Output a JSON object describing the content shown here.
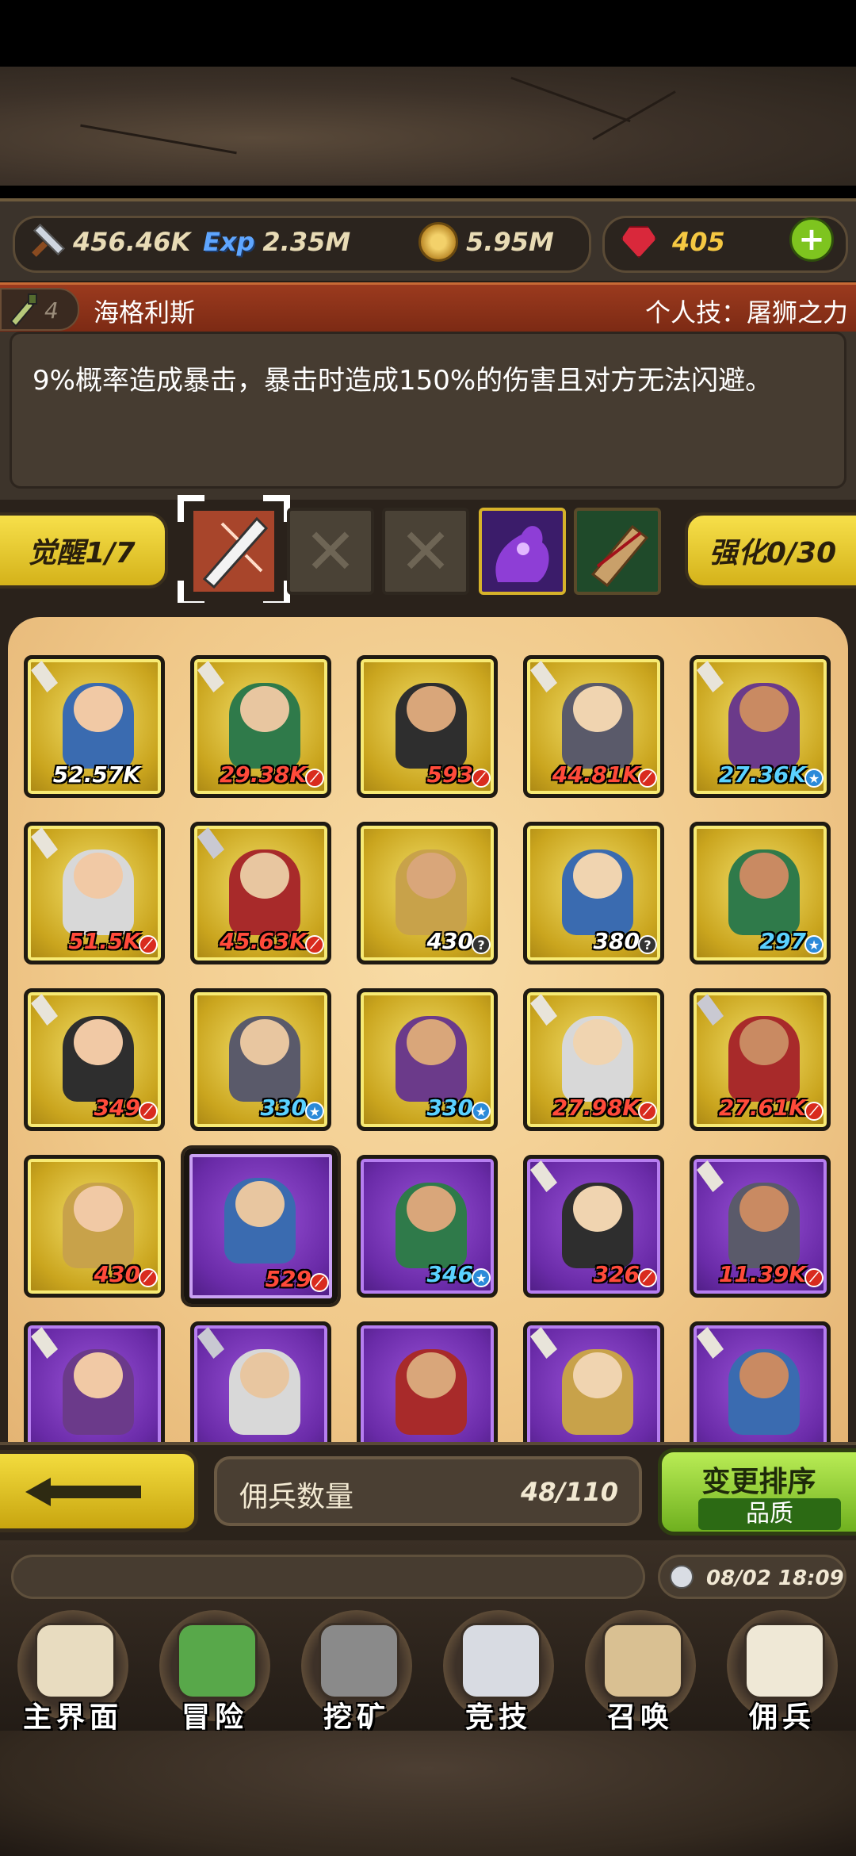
{
  "currency": {
    "attack": "456.46K",
    "exp_label": "Exp",
    "exp": "2.35M",
    "gold": "5.95M",
    "gems": "405",
    "add_label": "+"
  },
  "hero": {
    "level": "4",
    "name": "海格利斯",
    "skill": "个人技：屠狮之力",
    "description": "9%概率造成暴击，暴击时造成150%的伤害且对方无法闪避。"
  },
  "skills": {
    "awaken_label": "觉醒1/7",
    "enhance_label": "强化0/30",
    "empty_mark": "✕"
  },
  "mercenaries": [
    {
      "level": "52.57K",
      "color": "gold",
      "lvcolor": "white",
      "badge": "",
      "tag": "tag"
    },
    {
      "level": "29.38K",
      "color": "gold",
      "lvcolor": "red",
      "badge": "red",
      "tag": "tag"
    },
    {
      "level": "593",
      "color": "gold",
      "lvcolor": "red",
      "badge": "red",
      "tag": ""
    },
    {
      "level": "44.81K",
      "color": "gold",
      "lvcolor": "red",
      "badge": "red",
      "tag": "tag"
    },
    {
      "level": "27.36K",
      "color": "gold",
      "lvcolor": "blue",
      "badge": "blue",
      "tag": "tag"
    },
    {
      "level": "51.5K",
      "color": "gold",
      "lvcolor": "red",
      "badge": "red",
      "tag": "tag"
    },
    {
      "level": "45.63K",
      "color": "gold",
      "lvcolor": "red",
      "badge": "red",
      "tag": "sword"
    },
    {
      "level": "430",
      "color": "gold",
      "lvcolor": "white",
      "badge": "gray",
      "tag": ""
    },
    {
      "level": "380",
      "color": "gold",
      "lvcolor": "white",
      "badge": "gray",
      "tag": ""
    },
    {
      "level": "297",
      "color": "gold",
      "lvcolor": "blue",
      "badge": "blue",
      "tag": ""
    },
    {
      "level": "349",
      "color": "gold",
      "lvcolor": "red",
      "badge": "red",
      "tag": "tag"
    },
    {
      "level": "330",
      "color": "gold",
      "lvcolor": "blue",
      "badge": "blue",
      "tag": ""
    },
    {
      "level": "330",
      "color": "gold",
      "lvcolor": "blue",
      "badge": "blue",
      "tag": ""
    },
    {
      "level": "27.98K",
      "color": "gold",
      "lvcolor": "red",
      "badge": "red",
      "tag": "tag"
    },
    {
      "level": "27.61K",
      "color": "gold",
      "lvcolor": "red",
      "badge": "red",
      "tag": "sword"
    },
    {
      "level": "430",
      "color": "gold",
      "lvcolor": "red",
      "badge": "red",
      "tag": ""
    },
    {
      "level": "529",
      "color": "purple",
      "lvcolor": "red",
      "badge": "red",
      "tag": "",
      "selected": true
    },
    {
      "level": "346",
      "color": "purple",
      "lvcolor": "blue",
      "badge": "blue",
      "tag": ""
    },
    {
      "level": "326",
      "color": "purple",
      "lvcolor": "red",
      "badge": "red",
      "tag": "tag"
    },
    {
      "level": "11.39K",
      "color": "purple",
      "lvcolor": "red",
      "badge": "red",
      "tag": "tag"
    },
    {
      "level": "",
      "color": "purple",
      "lvcolor": "red",
      "badge": "",
      "tag": "tag"
    },
    {
      "level": "",
      "color": "purple",
      "lvcolor": "red",
      "badge": "",
      "tag": "sword"
    },
    {
      "level": "",
      "color": "purple",
      "lvcolor": "red",
      "badge": "",
      "tag": ""
    },
    {
      "level": "",
      "color": "purple",
      "lvcolor": "red",
      "badge": "",
      "tag": "tag"
    },
    {
      "level": "",
      "color": "purple",
      "lvcolor": "red",
      "badge": "",
      "tag": "tag"
    }
  ],
  "bottom": {
    "count_label": "佣兵数量",
    "count_value": "48/110",
    "sort_label": "变更排序",
    "sort_mode": "品质"
  },
  "status": {
    "time": "08/02 18:09"
  },
  "nav": [
    {
      "label": "主界面",
      "icon": "map-scroll-icon"
    },
    {
      "label": "冒险",
      "icon": "island-icon"
    },
    {
      "label": "挖矿",
      "icon": "pickaxe-icon"
    },
    {
      "label": "竞技",
      "icon": "crossed-swords-icon"
    },
    {
      "label": "召唤",
      "icon": "summon-scroll-icon"
    },
    {
      "label": "佣兵",
      "icon": "tent-icon"
    }
  ]
}
